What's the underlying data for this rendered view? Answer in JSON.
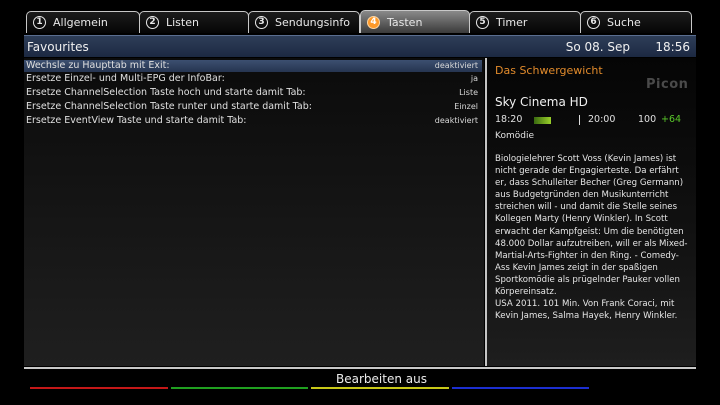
{
  "tabs": [
    {
      "num": "1",
      "label": "Allgemein"
    },
    {
      "num": "2",
      "label": "Listen"
    },
    {
      "num": "3",
      "label": "Sendungsinfo"
    },
    {
      "num": "4",
      "label": "Tasten"
    },
    {
      "num": "5",
      "label": "Timer"
    },
    {
      "num": "6",
      "label": "Suche"
    }
  ],
  "header": {
    "title": "Favourites",
    "date": "So 08. Sep",
    "time": "18:56"
  },
  "settings": [
    {
      "label": "Wechsle zu Haupttab mit Exit:",
      "value": "deaktiviert"
    },
    {
      "label": "Ersetze Einzel- und Multi-EPG der InfoBar:",
      "value": "ja"
    },
    {
      "label": "Ersetze ChannelSelection Taste hoch und starte damit Tab:",
      "value": "Liste"
    },
    {
      "label": "Ersetze ChannelSelection Taste runter und starte damit Tab:",
      "value": "Einzel"
    },
    {
      "label": "Ersetze EventView Taste und starte damit Tab:",
      "value": "deaktiviert"
    }
  ],
  "event": {
    "title": "Das Schwergewicht",
    "picon": "Picon",
    "channel": "Sky Cinema HD",
    "start": "18:20",
    "end": "20:00",
    "duration": "100",
    "delta": "+64",
    "progress": 0.36,
    "genre": "Komödie",
    "description": "Biologielehrer Scott Voss (Kevin James) ist\nnicht gerade der Engagierteste. Da erfährt\ner, dass Schulleiter Becher (Greg Germann)\naus Budgetgründen den Musikunterricht\nstreichen will - und damit die Stelle seines\nKollegen Marty (Henry Winkler). In Scott\nerwacht der Kampfgeist: Um die benötigten\n48.000 Dollar aufzutreiben, will er als Mixed-\nMartial-Arts-Fighter in den Ring. - Comedy-\nAss Kevin James zeigt in der spaßigen\nSportkomödie als prügelnder Pauker vollen\nKörpereinsatz.\nUSA 2011. 101 Min. Von Frank Coraci, mit\nKevin James, Salma Hayek, Henry Winkler."
  },
  "footer": {
    "label": "Bearbeiten aus"
  },
  "colors": {
    "accent_orange": "#e28b2c",
    "header_blue": "#263550",
    "red": "#c41818",
    "green": "#20a020",
    "yellow": "#c8c818",
    "blue": "#1c2fd0"
  }
}
